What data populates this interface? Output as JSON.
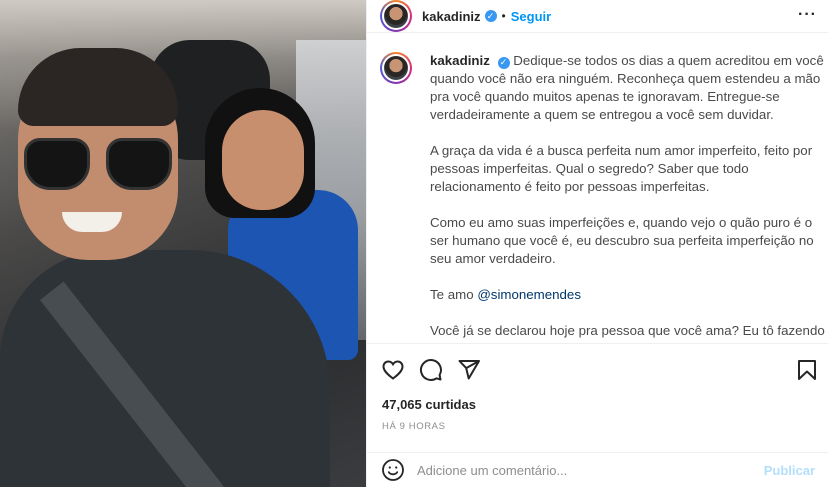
{
  "post": {
    "username": "kakadiniz",
    "separator": "•",
    "follow_label": "Seguir",
    "more_icon": "more-horizontal-icon"
  },
  "caption": {
    "username": "kakadiniz",
    "paragraphs": [
      "Dedique-se todos os dias a quem acreditou em você quando você não era ninguém. Reconheça quem estendeu a mão pra você quando muitos apenas te ignoravam. Entregue-se verdadeiramente a quem se entregou a você sem duvidar.",
      "A graça da vida é a busca perfeita num amor imperfeito, feito por pessoas imperfeitas. Qual o segredo? Saber que todo relacionamento é feito por pessoas imperfeitas.",
      "Como eu amo suas imperfeições e, quando vejo o quão puro é o ser humano que você é, eu descubro sua perfeita imperfeição no seu amor verdadeiro.",
      "Você já se declarou hoje pra pessoa que você ama? Eu tô fazendo isso agora... faz você também!"
    ],
    "love_prefix": "Te amo ",
    "mention": "@simonemendes"
  },
  "actions": {
    "like_icon": "heart-icon",
    "comment_icon": "comment-icon",
    "share_icon": "share-icon",
    "save_icon": "bookmark-icon"
  },
  "stats": {
    "likes_count": "47,065",
    "likes_label": "curtidas",
    "time_ago": "HÁ 9 HORAS"
  },
  "comment": {
    "placeholder": "Adicione um comentário...",
    "publish_label": "Publicar",
    "emoji_icon": "emoji-icon"
  },
  "colors": {
    "follow": "#0095f6",
    "verified": "#3897f0",
    "publish_disabled": "#b2dffc",
    "mention": "#00376b"
  }
}
